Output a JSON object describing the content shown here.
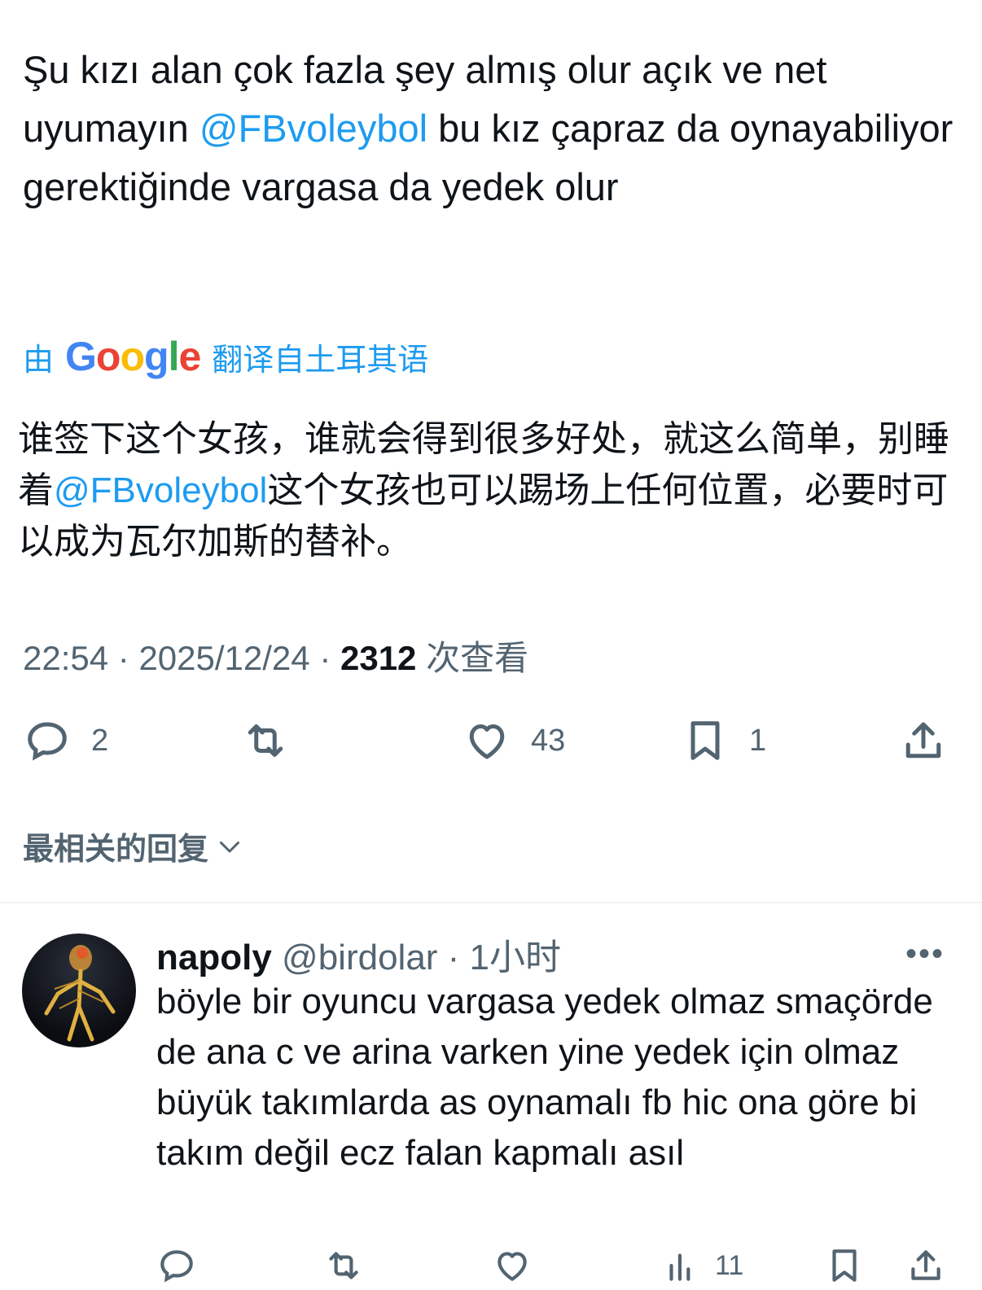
{
  "tweet": {
    "text_part1": "Şu kızı alan çok fazla şey almış olur açık ve net uyumayın ",
    "mention": "@FBvoleybol",
    "text_part2": " bu kız çapraz da oynayabiliyor gerektiğinde vargasa da yedek olur"
  },
  "translation": {
    "prefix": "由",
    "google": "Google",
    "suffix": "翻译自土耳其语",
    "text_part1": "谁签下这个女孩，谁就会得到很多好处，就这么简单，别睡着",
    "mention": "@FBvoleybol",
    "text_part2": "这个女孩也可以踢场上任何位置，必要时可以成为瓦尔加斯的替补。"
  },
  "meta": {
    "time": "22:54",
    "sep1": " · ",
    "date": "2025/12/24",
    "sep2": " · ",
    "views": "2312",
    "views_label": " 次查看"
  },
  "actions": {
    "replies": "2",
    "retweets": "",
    "likes": "43",
    "bookmarks": "1"
  },
  "replies_filter": "最相关的回复",
  "reply": {
    "name": "napoly",
    "handle": "@birdolar",
    "sep": " · ",
    "time": "1小时",
    "more": "•••",
    "text": "böyle bir oyuncu vargasa yedek olmaz smaçörde de ana c ve arina varken yine yedek için olmaz büyük takımlarda as oynamalı fb hic ona göre bi takım değil ecz falan kapmalı asıl",
    "views": "11"
  },
  "colors": {
    "accent": "#1d9bf0",
    "text": "#0f1419",
    "muted": "#536471"
  }
}
